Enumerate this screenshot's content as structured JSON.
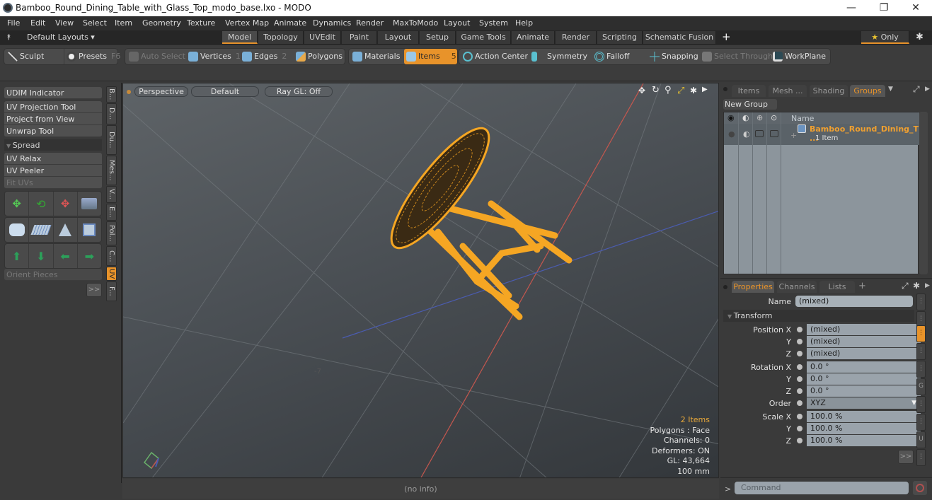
{
  "window": {
    "title": "Bamboo_Round_Dining_Table_with_Glass_Top_modo_base.lxo - MODO",
    "minimize": "—",
    "restore": "❐",
    "close": "✕"
  },
  "menu": [
    "File",
    "Edit",
    "View",
    "Select",
    "Item",
    "Geometry",
    "Texture",
    "Vertex Map",
    "Animate",
    "Dynamics",
    "Render",
    "MaxToModo",
    "Layout",
    "System",
    "Help"
  ],
  "layouts": {
    "default_label": "Default Layouts ▾",
    "tabs": [
      "Model",
      "Topology",
      "UVEdit",
      "Paint",
      "Layout",
      "Setup",
      "Game Tools",
      "Animate",
      "Render",
      "Scripting",
      "Schematic Fusion"
    ],
    "active": "Model",
    "add": "+",
    "only_label": "Only",
    "star": "★",
    "gear": "✱"
  },
  "toolbar": {
    "sculpt": "Sculpt",
    "presets": "Presets",
    "presets_key": "F6",
    "auto_select": "Auto Select",
    "vertices": "Vertices",
    "vertices_key": "1",
    "edges": "Edges",
    "edges_key": "2",
    "polygons": "Polygons",
    "materials": "Materials",
    "items": "Items",
    "items_key": "5",
    "action_center": "Action Center",
    "symmetry": "Symmetry",
    "falloff": "Falloff",
    "snapping": "Snapping",
    "select_through": "Select Through",
    "workplane": "WorkPlane"
  },
  "left_panel": {
    "buttons": [
      "UDIM Indicator",
      "UV Projection Tool",
      "Project from View",
      "Unwrap Tool"
    ],
    "spread_header": "Spread",
    "buttons2": [
      "UV Relax",
      "UV Peeler",
      "Fit UVs"
    ],
    "orient_pieces": "Orient Pieces",
    "more": ">>",
    "vtabs": [
      "B...",
      "D...",
      "Du...",
      "Mes...",
      "V...",
      "E...",
      "Pol...",
      "C...",
      "UV",
      "F..."
    ],
    "active_vtab": "UV"
  },
  "viewport": {
    "view": "Perspective",
    "shading": "Default",
    "raygl": "Ray GL: Off",
    "info": {
      "items": "2 Items",
      "polygons": "Polygons : Face",
      "channels": "Channels: 0",
      "deformers": "Deformers: ON",
      "gl": "GL: 43,664",
      "scale": "100 mm"
    },
    "status": "(no info)"
  },
  "groups_panel": {
    "tabs": [
      "Items",
      "Mesh ...",
      "Shading",
      "Groups"
    ],
    "active_tab": "Groups",
    "new_group": "New Group",
    "name_header": "Name",
    "row": {
      "name": "Bamboo_Round_Dining_T ...",
      "sub": "1 Item"
    }
  },
  "properties_panel": {
    "tabs": [
      "Properties",
      "Channels",
      "Lists"
    ],
    "active_tab": "Properties",
    "add": "+",
    "name_label": "Name",
    "name_value": "(mixed)",
    "transform_header": "Transform",
    "position": {
      "label": "Position X",
      "x": "(mixed)",
      "y": "(mixed)",
      "z": "(mixed)"
    },
    "rotation": {
      "label": "Rotation X",
      "x": "0.0 °",
      "y": "0.0 °",
      "z": "0.0 °"
    },
    "order": {
      "label": "Order",
      "value": "XYZ"
    },
    "scale": {
      "label": "Scale X",
      "x": "100.0 %",
      "y": "100.0 %",
      "z": "100.0 %"
    },
    "axis_y": "Y",
    "axis_z": "Z",
    "more": ">>"
  },
  "command": {
    "prompt": ">",
    "placeholder": "Command"
  },
  "colors": {
    "accent": "#e8932a",
    "selection": "#f5a623",
    "x_axis": "#c0504d",
    "z_axis": "#4a5aa8"
  }
}
